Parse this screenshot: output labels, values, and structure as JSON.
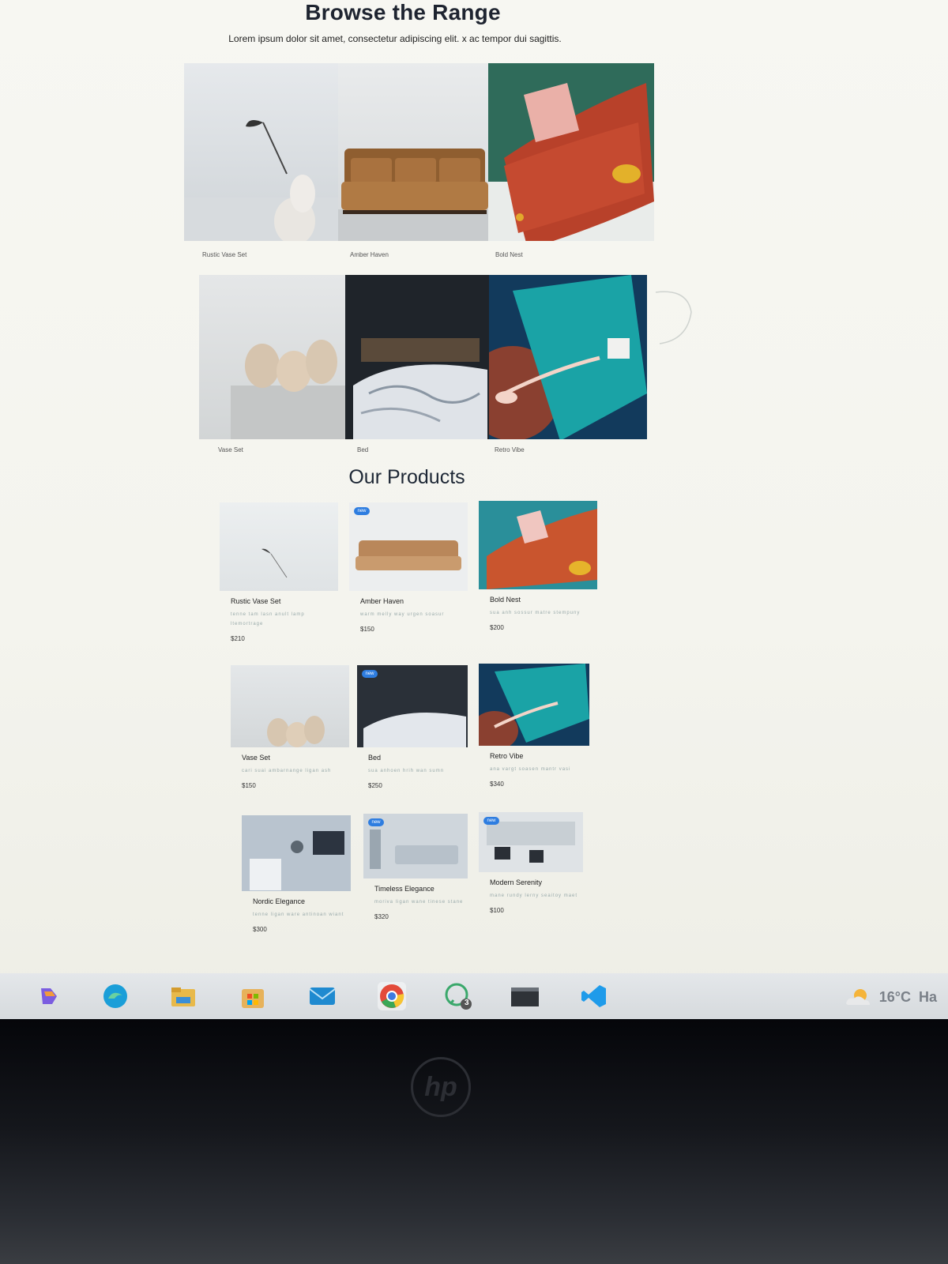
{
  "page": {
    "title": "Browse the Range",
    "subtitle": "Lorem ipsum dolor sit amet, consectetur adipiscing elit. x ac tempor dui sagittis."
  },
  "range": {
    "row1": [
      {
        "caption": "Rustic Vase Set"
      },
      {
        "caption": "Amber Haven"
      },
      {
        "caption": "Bold Nest"
      }
    ],
    "row2": [
      {
        "caption": "Vase Set"
      },
      {
        "caption": "Bed"
      },
      {
        "caption": "Retro Vibe"
      }
    ]
  },
  "products": {
    "title": "Our Products",
    "items": [
      {
        "name": "Rustic Vase Set",
        "desc": "tenne tam lasn anult lamp ltemortrage",
        "price": "$210",
        "badge": ""
      },
      {
        "name": "Amber Haven",
        "desc": "warm melly way urgen soasur",
        "price": "$150",
        "badge": "new"
      },
      {
        "name": "Bold Nest",
        "desc": "sua anh sossur matre stempuny",
        "price": "$200",
        "badge": ""
      },
      {
        "name": "Vase Set",
        "desc": "cari suai ambarnange ligan ash",
        "price": "$150",
        "badge": ""
      },
      {
        "name": "Bed",
        "desc": "sua anhoen hrih wan sumn",
        "price": "$250",
        "badge": "new"
      },
      {
        "name": "Retro Vibe",
        "desc": "ana vargt soasen mantr vasi",
        "price": "$340",
        "badge": ""
      },
      {
        "name": "Nordic Elegance",
        "desc": "tenne ligan ware antinoan wiant",
        "price": "$300",
        "badge": ""
      },
      {
        "name": "Timeless Elegance",
        "desc": "moriva ligan wane tinese stane",
        "price": "$320",
        "badge": "new"
      },
      {
        "name": "Modern Serenity",
        "desc": "mane rundy lerny seaitoy maet",
        "price": "$100",
        "badge": "new"
      }
    ]
  },
  "taskbar": {
    "icons": [
      "copilot-icon",
      "edge-icon",
      "file-explorer-icon",
      "store-icon",
      "mail-icon",
      "chrome-icon",
      "whatsapp-icon",
      "terminal-icon",
      "vscode-icon"
    ],
    "whatsapp_badge": "3",
    "weather": "16°C",
    "weather_trailing": "Ha"
  },
  "device": {
    "logo": "hp"
  },
  "colors": {
    "sofa_brown": "#9a6a3a",
    "sofa_red": "#b5422a",
    "teal": "#1b9aa0",
    "taskbar": "#dde0e3",
    "accent_blue": "#2e7de0"
  }
}
